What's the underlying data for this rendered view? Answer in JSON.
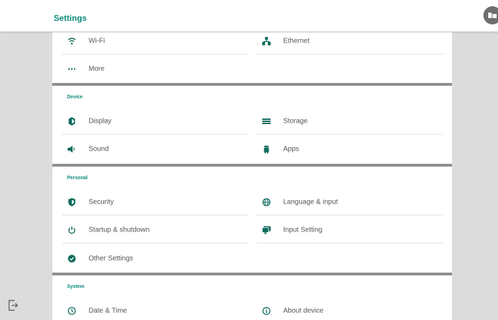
{
  "header": {
    "title": "Settings",
    "badge_icon": "window-icon"
  },
  "network": {
    "wifi": "Wi-Fi",
    "ethernet": "Ethernet",
    "more": "More"
  },
  "device": {
    "title": "Device",
    "display": "Display",
    "storage": "Storage",
    "sound": "Sound",
    "apps": "Apps"
  },
  "personal": {
    "title": "Personal",
    "security": "Security",
    "language": "Language & input",
    "startup": "Startup & shutdown",
    "input_setting": "Input Setting",
    "other": "Other Settings"
  },
  "system": {
    "title": "System",
    "datetime": "Date & Time",
    "about": "About device"
  },
  "colors": {
    "accent": "#0b8a7c",
    "icon": "#0f6b5f",
    "divider": "#8e8e8e"
  }
}
